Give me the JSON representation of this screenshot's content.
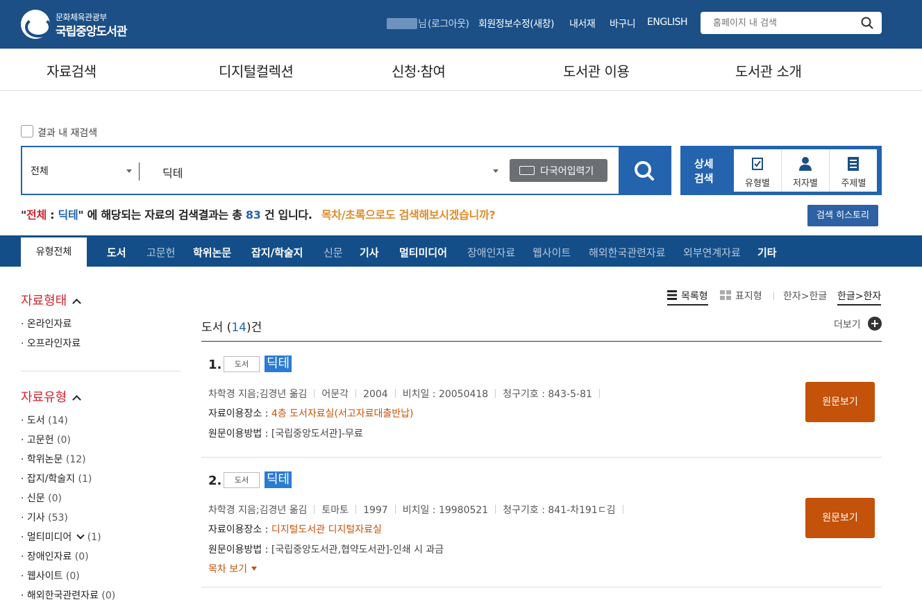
{
  "header": {
    "logo_sub": "문화체육관광부",
    "logo_main": "국립중앙도서관",
    "user_suffix": "님",
    "logout": "(로그아웃)",
    "member_edit": "회원정보수정(새창)",
    "my_library": "내서재",
    "cart": "바구니",
    "english": "ENGLISH",
    "search_placeholder": "홈페이지 내 검색"
  },
  "gnb": [
    "자료검색",
    "디지털컬렉션",
    "신청·참여",
    "도서관 이용",
    "도서관 소개"
  ],
  "search": {
    "rescan_label": "결과 내 재검색",
    "scope": "전체",
    "query": "딕테",
    "multilang_btn": "다국어입력기",
    "advanced_label": "상세 검색",
    "advanced_items": [
      "유형별",
      "저자별",
      "주제별"
    ],
    "history_btn": "검색 히스토리"
  },
  "result_msg": {
    "q_open": "\"",
    "scope": "전체",
    "colon": " : ",
    "query": "딕테",
    "mid": "\" 에 해당되는 자료의 검색결과는 총 ",
    "total": "83",
    "tail": " 건 입니다.",
    "suggest": "목차/초록으로도 검색해보시겠습니까?"
  },
  "tabs": {
    "active": "유형전체",
    "items": [
      {
        "label": "도서",
        "dim": false
      },
      {
        "label": "고문헌",
        "dim": true
      },
      {
        "label": "학위논문",
        "dim": false
      },
      {
        "label": "잡지/학술지",
        "dim": false
      },
      {
        "label": "신문",
        "dim": true
      },
      {
        "label": "기사",
        "dim": false
      },
      {
        "label": "멀티미디어",
        "dim": false
      },
      {
        "label": "장애인자료",
        "dim": true
      },
      {
        "label": "웹사이트",
        "dim": true
      },
      {
        "label": "해외한국관련자료",
        "dim": true
      },
      {
        "label": "외부연계자료",
        "dim": true
      },
      {
        "label": "기타",
        "dim": false
      }
    ]
  },
  "facets": {
    "form_title": "자료형태",
    "form_items": [
      "온라인자료",
      "오프라인자료"
    ],
    "type_title": "자료유형",
    "type_items": [
      {
        "label": "도서",
        "count": "(14)"
      },
      {
        "label": "고문헌",
        "count": "(0)"
      },
      {
        "label": "학위논문",
        "count": "(12)"
      },
      {
        "label": "잡지/학술지",
        "count": "(1)"
      },
      {
        "label": "신문",
        "count": "(0)"
      },
      {
        "label": "기사",
        "count": "(53)"
      },
      {
        "label": "멀티미디어",
        "count": "(1)"
      },
      {
        "label": "장애인자료",
        "count": "(0)"
      },
      {
        "label": "웹사이트",
        "count": "(0)"
      },
      {
        "label": "해외한국관련자료",
        "count": "(0)"
      }
    ]
  },
  "view": {
    "list": "목록형",
    "table": "표지형",
    "hanja_to_hangul": "한자>한글",
    "hangul_to_hanja": "한글>한자"
  },
  "section": {
    "title_prefix": "도서 (",
    "count": "14",
    "title_suffix": ")건",
    "more": "더보기"
  },
  "results": [
    {
      "num": "1.",
      "badge": "도서",
      "title": "딕테",
      "author": "차학경 지음;김경년 옮김",
      "publisher": "어문각",
      "year": "2004",
      "preserve_date": "비치일 : 20050418",
      "call_no": "청구기호 : 843-5-81",
      "location_label": "자료이용장소 : ",
      "location": "4층 도서자료실(서고자료대출반납)",
      "access_label": "원문이용방법 : ",
      "access": "[국립중앙도서관]-무료",
      "view_btn": "원문보기"
    },
    {
      "num": "2.",
      "badge": "도서",
      "title": "딕테",
      "author": "차학경 지음;김경년 옮김",
      "publisher": "토마토",
      "year": "1997",
      "preserve_date": "비치일 : 19980521",
      "call_no": "청구기호 : 841-차191ㄷ김",
      "location_label": "자료이용장소 : ",
      "location": "디지털도서관 디지털자료실",
      "access_label": "원문이용방법 : ",
      "access": "[국립중앙도서관,협약도서관]-인쇄 시 과금",
      "toc": "목차 보기",
      "view_btn": "원문보기"
    }
  ],
  "colors": {
    "header_bg": "#1b4f86",
    "primary": "#2463ae",
    "accent_red": "#d0232e",
    "button_orange": "#c4520a"
  }
}
